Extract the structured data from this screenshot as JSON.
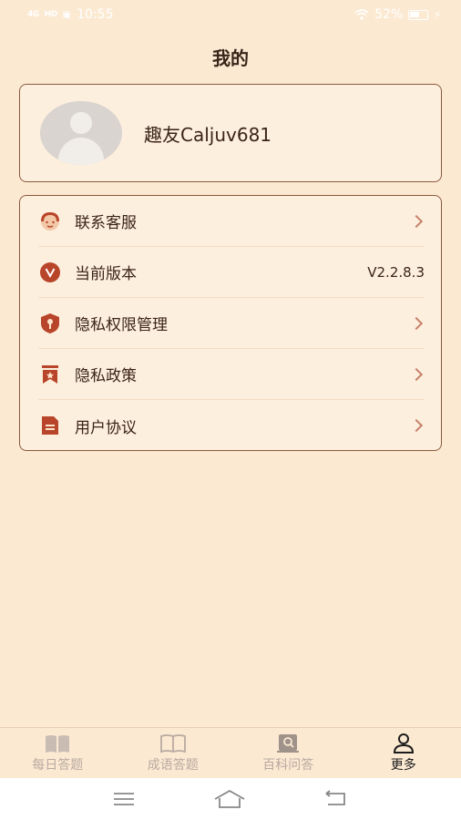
{
  "status": {
    "signal_1": "4G",
    "signal_2": "HD",
    "time": "10:55",
    "battery_pct": "52%"
  },
  "header": {
    "title": "我的"
  },
  "profile": {
    "username": "趣友Caljuv681"
  },
  "menu": {
    "items": [
      {
        "label": "联系客服",
        "value": ""
      },
      {
        "label": "当前版本",
        "value": "V2.2.8.3"
      },
      {
        "label": "隐私权限管理",
        "value": ""
      },
      {
        "label": "隐私政策",
        "value": ""
      },
      {
        "label": "用户协议",
        "value": ""
      }
    ]
  },
  "tabs": [
    {
      "label": "每日答题",
      "icon": "open-book-icon"
    },
    {
      "label": "成语答题",
      "icon": "book-outline-icon"
    },
    {
      "label": "百科问答",
      "icon": "search-book-icon"
    },
    {
      "label": "更多",
      "icon": "person-icon",
      "active": true
    }
  ],
  "colors": {
    "background": "#fbe9d2",
    "card_border": "#8a5a3e",
    "accent": "#b8452a",
    "chevron": "#c6826b"
  }
}
